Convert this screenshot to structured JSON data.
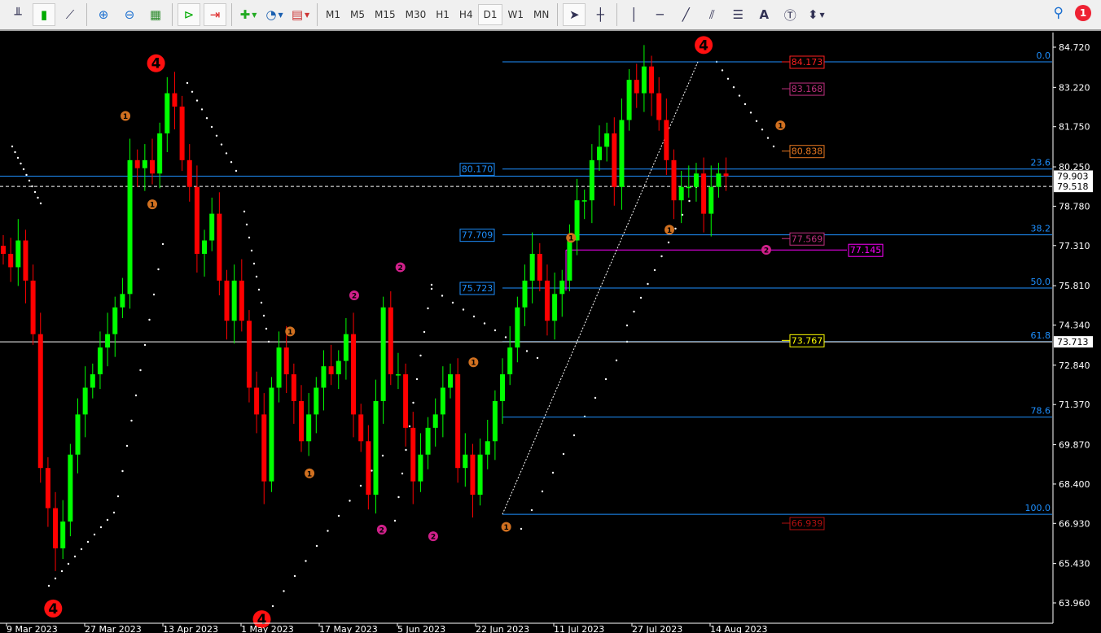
{
  "toolbar": {
    "tools": [
      "bar-chart",
      "candlestick-chart",
      "line-chart",
      "zoom-in",
      "zoom-out",
      "tile-windows",
      "auto-scroll",
      "chart-shift",
      "new-indicator",
      "periods",
      "templates"
    ],
    "timeframes": [
      "M1",
      "M5",
      "M15",
      "M30",
      "H1",
      "H4",
      "D1",
      "W1",
      "MN"
    ],
    "active_timeframe": "D1",
    "draw_tools": [
      "cursor",
      "crosshair",
      "vertical-line",
      "horizontal-line",
      "trendline",
      "equidistant-channel",
      "fibonacci",
      "text",
      "text-label",
      "arrows"
    ],
    "text_tool_label": "A",
    "notification_count": "1"
  },
  "colors": {
    "up": "#00ff00",
    "down": "#ff0000",
    "fib": "#1e90ff",
    "magenta": "#ff00ff"
  },
  "price_axis": [
    "84.720",
    "83.220",
    "81.750",
    "80.250",
    "78.780",
    "77.310",
    "75.810",
    "74.340",
    "72.840",
    "71.370",
    "69.870",
    "68.400",
    "66.930",
    "65.430",
    "63.960"
  ],
  "price_markers": [
    {
      "value": "79.903",
      "price": 79.903
    },
    {
      "value": "73.713",
      "price": 73.713
    }
  ],
  "dashed_line_price": 79.518,
  "date_axis": [
    "9 Mar 2023",
    "27 Mar 2023",
    "13 Apr 2023",
    "1 May 2023",
    "17 May 2023",
    "5 Jun 2023",
    "22 Jun 2023",
    "11 Jul 2023",
    "27 Jul 2023",
    "14 Aug 2023"
  ],
  "fibonacci": [
    {
      "level": "0.0",
      "price": 84.173
    },
    {
      "level": "23.6",
      "price": 80.17
    },
    {
      "level": "38.2",
      "price": 77.709
    },
    {
      "level": "50.0",
      "price": 75.723
    },
    {
      "level": "61.8",
      "price": 73.72
    },
    {
      "level": "78.6",
      "price": 70.9
    },
    {
      "level": "100.0",
      "price": 67.27
    }
  ],
  "fib_value_labels": [
    "80.170",
    "77.709",
    "75.723"
  ],
  "level_labels": [
    {
      "text": "84.173",
      "price": 84.173,
      "color": "#ff2020"
    },
    {
      "text": "83.168",
      "price": 83.168,
      "color": "#c0307f"
    },
    {
      "text": "80.838",
      "price": 80.838,
      "color": "#e87820"
    },
    {
      "text": "77.569",
      "price": 77.569,
      "color": "#c0307f"
    },
    {
      "text": "73.767",
      "price": 73.767,
      "color": "#ffff00"
    },
    {
      "text": "66.939",
      "price": 66.939,
      "color": "#b01010"
    }
  ],
  "magenta_level": {
    "text": "77.145",
    "price": 77.145
  },
  "closes": [
    77,
    76.5,
    77.5,
    76,
    74,
    69,
    67.5,
    66,
    67,
    69.5,
    71,
    72,
    72.5,
    73.5,
    74,
    75,
    75.5,
    80.5,
    80.2,
    80.5,
    80,
    81.5,
    83,
    82.5,
    80.5,
    79.5,
    77,
    77.5,
    78.5,
    76,
    74.5,
    76,
    74.5,
    72,
    71,
    68.5,
    72,
    73.5,
    72.5,
    71.5,
    70,
    71,
    72,
    72.8,
    72.5,
    73,
    74,
    71,
    70,
    68,
    71.5,
    75,
    72.5,
    72.5,
    70.5,
    68.5,
    69.5,
    70.5,
    71,
    72,
    72.5,
    69,
    69.5,
    68,
    69.5,
    70,
    71.5,
    72.5,
    73.5,
    75,
    76,
    77,
    76,
    74.5,
    75.5,
    76,
    77.5,
    79,
    79,
    80.5,
    81,
    81.5,
    79.5,
    82,
    83.5,
    83,
    84,
    83,
    82,
    80.5,
    79,
    79.5,
    79.5,
    80,
    78.5,
    79.5,
    80,
    79.9
  ],
  "waves": [
    {
      "label": "4",
      "kind": "big",
      "bar": 20.5,
      "price": 84.12
    },
    {
      "label": "4",
      "kind": "big",
      "bar": 6.7,
      "price": 63.75
    },
    {
      "label": "4",
      "kind": "big",
      "bar": 34.7,
      "price": 63.35
    },
    {
      "label": "4",
      "kind": "big",
      "bar": 94,
      "price": 84.8
    },
    {
      "label": "1",
      "kind": "w1",
      "bar": 16.4,
      "price": 82.15
    },
    {
      "label": "1",
      "kind": "w1",
      "bar": 20,
      "price": 78.85
    },
    {
      "label": "1",
      "kind": "w1",
      "bar": 38.5,
      "price": 74.1
    },
    {
      "label": "1",
      "kind": "w1",
      "bar": 41.1,
      "price": 68.8
    },
    {
      "label": "1",
      "kind": "w1",
      "bar": 63.1,
      "price": 72.95
    },
    {
      "label": "1",
      "kind": "w1",
      "bar": 67.5,
      "price": 66.8
    },
    {
      "label": "1",
      "kind": "w1",
      "bar": 76.2,
      "price": 77.6
    },
    {
      "label": "1",
      "kind": "w1",
      "bar": 89.4,
      "price": 77.9
    },
    {
      "label": "1",
      "kind": "w1",
      "bar": 104.3,
      "price": 81.8
    },
    {
      "label": "2",
      "kind": "w2",
      "bar": 47.1,
      "price": 75.45
    },
    {
      "label": "2",
      "kind": "w2",
      "bar": 53.3,
      "price": 76.5
    },
    {
      "label": "2",
      "kind": "w2",
      "bar": 50.8,
      "price": 66.7
    },
    {
      "label": "2",
      "kind": "w2",
      "bar": 57.7,
      "price": 66.45
    },
    {
      "label": "2",
      "kind": "w2",
      "bar": 102.4,
      "price": 77.15
    }
  ]
}
